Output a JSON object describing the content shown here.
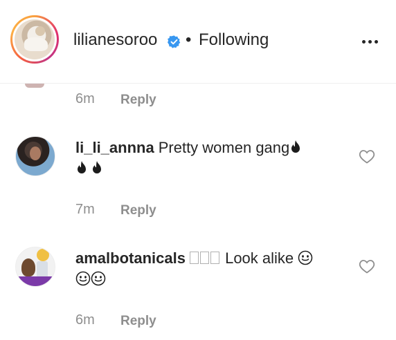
{
  "header": {
    "username": "lilianesoroo",
    "separator": "•",
    "follow_status": "Following"
  },
  "comments": [
    {
      "time": "6m",
      "reply_label": "Reply"
    },
    {
      "username": "li_li_annna",
      "text": "Pretty women gang",
      "time": "7m",
      "reply_label": "Reply"
    },
    {
      "username": "amalbotanicals",
      "text": "Look alike",
      "time": "6m",
      "reply_label": "Reply"
    }
  ],
  "icons": {
    "verified": "verified-badge-icon",
    "more": "more-options-icon",
    "heart": "heart-outline-icon",
    "fire": "fire-emoji",
    "smile": "smiling-face-emoji"
  },
  "colors": {
    "verified_blue": "#3897f0",
    "text": "#262626",
    "muted": "#8e8e8e",
    "divider": "#efefef"
  }
}
